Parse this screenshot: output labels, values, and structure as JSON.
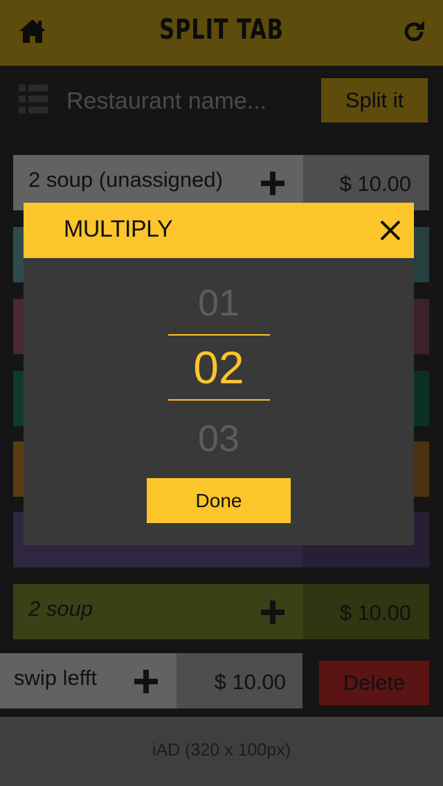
{
  "header": {
    "title": "SPLIT TAB",
    "home_icon": "home-icon",
    "refresh_icon": "refresh-icon"
  },
  "restaurant": {
    "placeholder": "Restaurant name...",
    "list_icon": "list-icon",
    "split_label": "Split it"
  },
  "rows": [
    {
      "label": "2 soup (unassigned)",
      "price": "$ 10.00",
      "italic": false
    },
    {
      "label": "",
      "price": ""
    },
    {
      "label": "",
      "price": ""
    },
    {
      "label": "",
      "price": ""
    },
    {
      "label": "",
      "price": ""
    },
    {
      "label": "",
      "price": ""
    },
    {
      "label": "2 soup",
      "price": "$ 10.00",
      "italic": true
    }
  ],
  "swipe_row": {
    "label": "swip lefft",
    "price": "$ 10.00",
    "delete_label": "Delete"
  },
  "ad": {
    "text": "iAD (320 x 100px)"
  },
  "modal": {
    "title": "MULTIPLY",
    "picker": {
      "previous": "01",
      "selected": "02",
      "next": "03"
    },
    "done_label": "Done"
  },
  "colors": {
    "accent": "#fbc52b",
    "overlay_header": "#5e4c0d",
    "delete": "#5a1414"
  }
}
